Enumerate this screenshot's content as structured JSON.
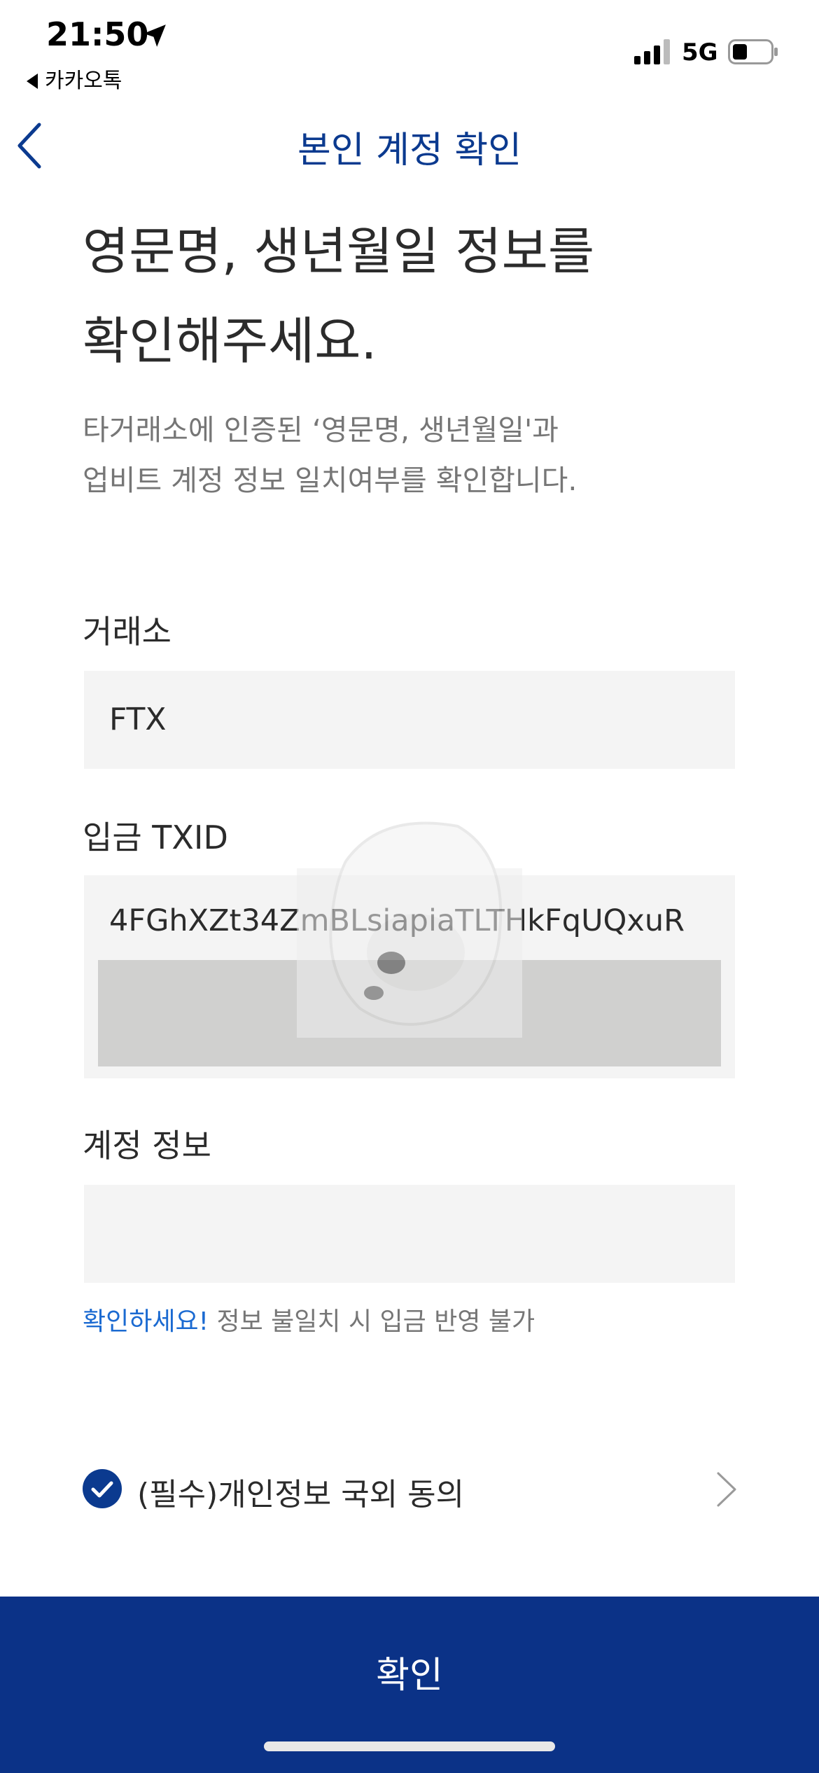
{
  "status_bar": {
    "time": "21:50",
    "back_app": "카카오톡",
    "network": "5G"
  },
  "nav": {
    "title": "본인 계정 확인"
  },
  "headline": {
    "line1": "영문명, 생년월일 정보를",
    "line2": "확인해주세요."
  },
  "description": {
    "line1": "타거래소에 인증된 ‘영문명, 생년월일'과",
    "line2": "업비트 계정 정보 일치여부를 확인합니다."
  },
  "fields": {
    "exchange_label": "거래소",
    "exchange_value": "FTX",
    "txid_label": "입금 TXID",
    "txid_value": "4FGhXZt34ZmBLsiapiaTLTHkFqUQxuR",
    "account_label": "계정 정보",
    "account_value": ""
  },
  "warning": {
    "highlight": "확인하세요!",
    "text": "정보 불일치 시 입금 반영 불가"
  },
  "consent": {
    "label": "(필수)개인정보 국외 동의",
    "checked": true
  },
  "confirm_button": {
    "label": "확인"
  },
  "colors": {
    "primary": "#0b3287",
    "accent_link": "#1b6ad1",
    "field_bg": "#f4f4f4"
  }
}
